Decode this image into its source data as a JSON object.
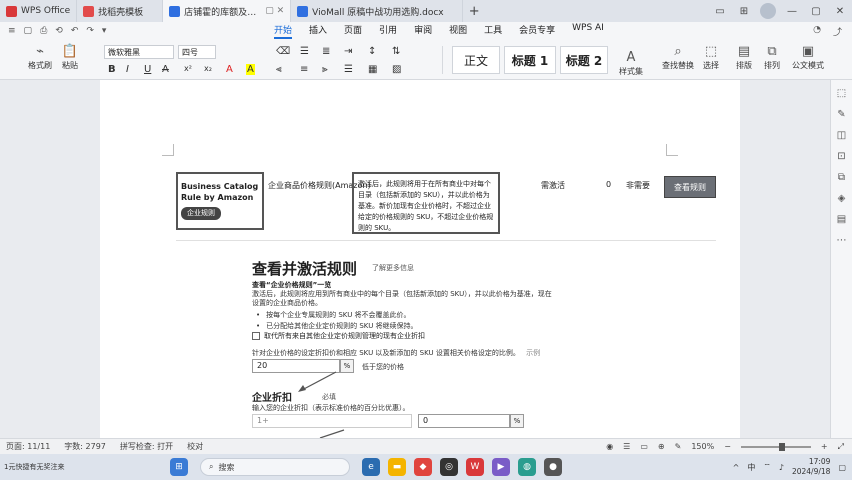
{
  "titlebar": {
    "tabs": [
      {
        "label": "WPS Office",
        "color": "#d9383a",
        "active": false
      },
      {
        "label": "找稻壳模板",
        "color": "#e24b4b",
        "active": false
      },
      {
        "label": "店铺霍的库额及针对不确员友",
        "color": "#2f6fe0",
        "active": true
      },
      {
        "label": "VioMall 原稿中战功用选购.docx",
        "color": "#2f6fe0",
        "active": false
      }
    ],
    "new_tab": "+"
  },
  "menubar": {
    "quick_icons": [
      "≡",
      "▢",
      "⎙",
      "⟲",
      "↶",
      "↷",
      "▾"
    ],
    "menus": [
      "开始",
      "插入",
      "页面",
      "引用",
      "审阅",
      "视图",
      "工具",
      "会员专享"
    ],
    "ai": "WPS AI",
    "right_icons": [
      "◔",
      "⤴"
    ]
  },
  "ribbon": {
    "format_painter": "格式刷",
    "paste": "粘贴",
    "font_name": "微软雅黑",
    "font_size": "四号",
    "format_buttons": [
      "B",
      "I",
      "U",
      "A",
      "x²",
      "x₂",
      "A",
      "A"
    ],
    "styles": [
      "正文",
      "标题 1",
      "标题 2"
    ],
    "style_set": "样式集",
    "find_replace": "查找替换",
    "select": "选择",
    "layout": "排版",
    "arrange": "排列",
    "formula": "公文模式"
  },
  "document": {
    "row": {
      "title": "Business Catalog Rule by Amazon",
      "chip": "企业规则",
      "cn_name": "企业商品价格规则(Amazon)",
      "description": "激活后，此规则将用于在所有商业中对每个目录（包括新添加的 SKU），并以此价格为基准。新价加现有企业价格时，不超过企业给定的价格规则的 SKU，不超过企业价格规则的 SKU。",
      "status": "需激活",
      "count": "0",
      "type": "非需要",
      "button": "查看规则"
    },
    "rules_heading": "查看并激活规则",
    "rules_link": "了解更多信息",
    "section_label": "查看“企业价格规则”一览",
    "para1": "激活后，此规则将应用到所有商业中的每个目录（包括新添加的 SKU），并以此价格为基准，现在",
    "para2": "设置的企业商品价格。",
    "bullets": [
      "按每个企业专属规则的 SKU 将不会覆盖此价。",
      "已分配给其他企业定价规则的 SKU 将继续保持。"
    ],
    "check_label": "取代所有来自其他企业定价规则管理的现有企业折扣",
    "slider_label": "针对企业价格的设定折扣价和相应 SKU 以及新添加的 SKU 设置相关价格设定的比例。",
    "slider_note": "示例",
    "pct_value": "20",
    "pct_suffix": "%",
    "pct_note": "低于您的价格",
    "discount_heading": "企业折扣",
    "discount_note": "必填",
    "discount_desc": "输入您的企业折扣（表示标准价格的百分比优惠）。",
    "discount_left_value": "1+",
    "discount_right_value": "0",
    "discount_suffix": "%"
  },
  "sidebar_icons": [
    "⬚",
    "✎",
    "◫",
    "⊡",
    "⧉",
    "◈",
    "▤",
    "⋯"
  ],
  "statusbar": {
    "page": "页面: 11/11",
    "words": "字数: 2797",
    "spell": "拼写检查: 打开",
    "proof": "校对",
    "zoom": "150%",
    "zoom_fraction": 0.6
  },
  "taskbar": {
    "ticker": "1元快捷有无奖注来",
    "search_placeholder": "搜索",
    "time": "17:09",
    "date": "2024/9/18",
    "lang": "中"
  }
}
